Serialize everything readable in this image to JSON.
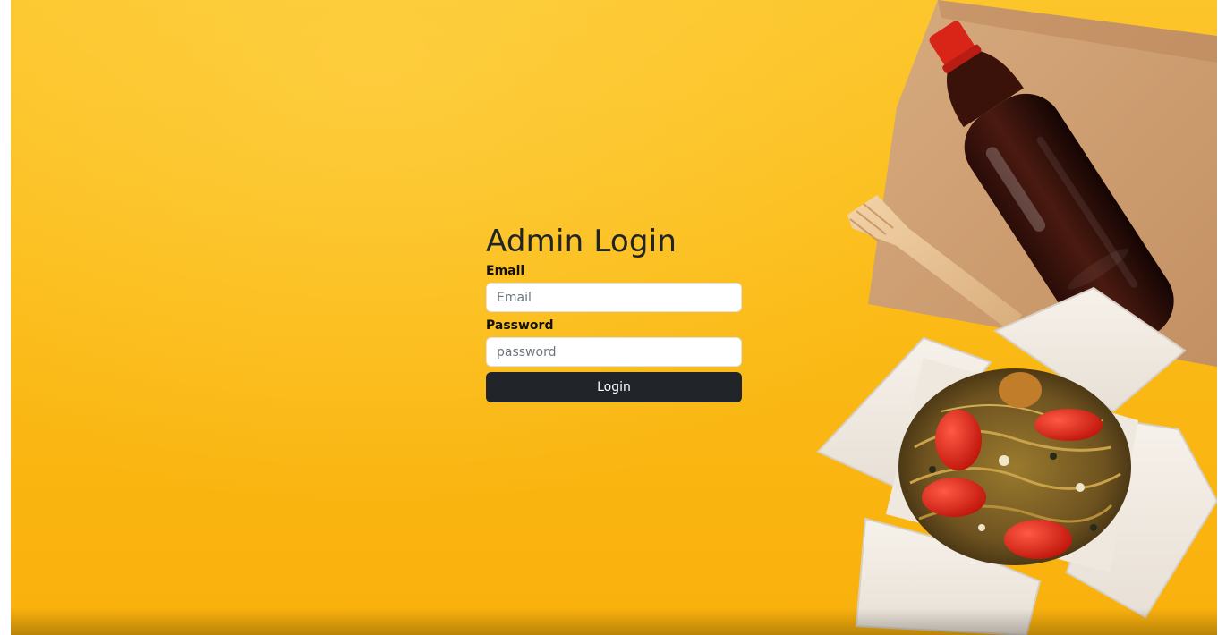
{
  "login": {
    "title": "Admin Login",
    "email_label": "Email",
    "email_placeholder": "Email",
    "password_label": "Password",
    "password_placeholder": "password",
    "submit_label": "Login"
  },
  "colors": {
    "background_yellow": "#fbbb17",
    "button_dark": "#212529",
    "input_background": "#ffffff"
  },
  "decor": {
    "icons": [
      "soda-bottle-icon",
      "wooden-fork-icon",
      "paper-napkin-icon",
      "noodle-box-icon"
    ]
  }
}
